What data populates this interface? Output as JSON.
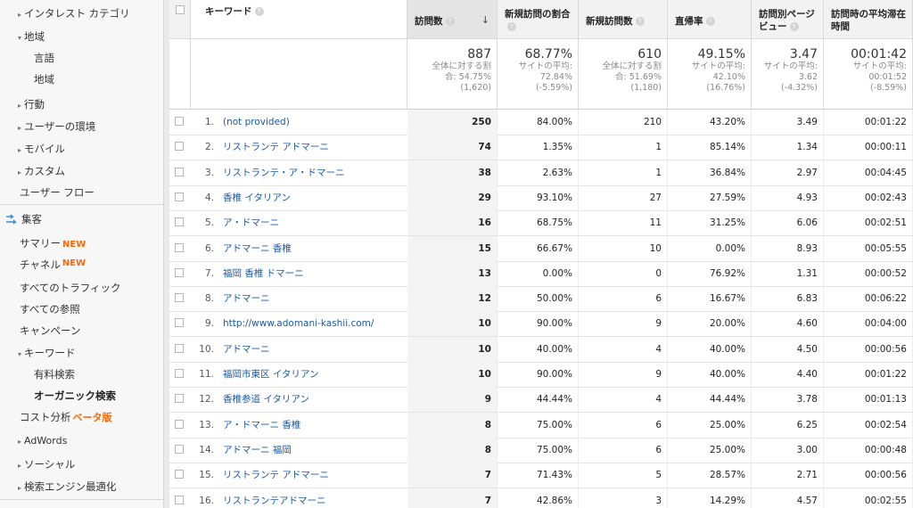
{
  "sidebar": {
    "items": [
      {
        "label": "インタレスト カテゴリ",
        "arrow": "▸"
      },
      {
        "label": "地域",
        "arrow": "▾"
      },
      {
        "label": "言語",
        "arrow": ""
      },
      {
        "label": "地域",
        "arrow": ""
      },
      {
        "label": "行動",
        "arrow": "▸"
      },
      {
        "label": "ユーザーの環境",
        "arrow": "▸"
      },
      {
        "label": "モバイル",
        "arrow": "▸"
      },
      {
        "label": "カスタム",
        "arrow": "▸"
      },
      {
        "label": "ユーザー フロー",
        "arrow": ""
      },
      {
        "label": "集客",
        "arrow": ""
      },
      {
        "label": "サマリー",
        "arrow": "",
        "badge": "NEW"
      },
      {
        "label": "チャネル",
        "arrow": "",
        "badge": "NEW"
      },
      {
        "label": "すべてのトラフィック",
        "arrow": ""
      },
      {
        "label": "すべての参照",
        "arrow": ""
      },
      {
        "label": "キャンペーン",
        "arrow": ""
      },
      {
        "label": "キーワード",
        "arrow": "▾"
      },
      {
        "label": "有料検索",
        "arrow": ""
      },
      {
        "label": "オーガニック検索",
        "arrow": ""
      },
      {
        "label": "コスト分析",
        "arrow": "",
        "beta": "ベータ版"
      },
      {
        "label": "AdWords",
        "arrow": "▸"
      },
      {
        "label": "ソーシャル",
        "arrow": "▸"
      },
      {
        "label": "検索エンジン最適化",
        "arrow": "▸"
      }
    ]
  },
  "table": {
    "headers": {
      "keyword": "キーワード",
      "visits": "訪問数",
      "new_visit_rate": "新規訪問の割合",
      "new_visits": "新規訪問数",
      "bounce": "直帰率",
      "pv_per_visit": "訪問別ページビュー",
      "avg_duration": "訪問時の平均滞在時間"
    },
    "totals": {
      "visits": {
        "big": "887",
        "l1": "全体に対する割",
        "l2": "合: 54.75%",
        "l3": "(1,620)"
      },
      "new_visit_rate": {
        "big": "68.77%",
        "l1": "サイトの平均:",
        "l2": "72.84%",
        "l3": "(-5.59%)"
      },
      "new_visits": {
        "big": "610",
        "l1": "全体に対する割",
        "l2": "合: 51.69%",
        "l3": "(1,180)"
      },
      "bounce": {
        "big": "49.15%",
        "l1": "サイトの平均:",
        "l2": "42.10%",
        "l3": "(16.76%)"
      },
      "pv_per_visit": {
        "big": "3.47",
        "l1": "サイトの平均:",
        "l2": "3.62",
        "l3": "(-4.32%)"
      },
      "avg_duration": {
        "big": "00:01:42",
        "l1": "サイトの平均:",
        "l2": "00:01:52",
        "l3": "(-8.59%)"
      }
    },
    "rows": [
      {
        "idx": "1.",
        "kw": "(not provided)",
        "visits": "250",
        "nvr": "84.00%",
        "nv": "210",
        "bounce": "43.20%",
        "pv": "3.49",
        "dur": "00:01:22"
      },
      {
        "idx": "2.",
        "kw": "リストランテ アドマーニ",
        "visits": "74",
        "nvr": "1.35%",
        "nv": "1",
        "bounce": "85.14%",
        "pv": "1.34",
        "dur": "00:00:11"
      },
      {
        "idx": "3.",
        "kw": "リストランテ・ア・ドマーニ",
        "visits": "38",
        "nvr": "2.63%",
        "nv": "1",
        "bounce": "36.84%",
        "pv": "2.97",
        "dur": "00:04:45"
      },
      {
        "idx": "4.",
        "kw": "香椎 イタリアン",
        "visits": "29",
        "nvr": "93.10%",
        "nv": "27",
        "bounce": "27.59%",
        "pv": "4.93",
        "dur": "00:02:43"
      },
      {
        "idx": "5.",
        "kw": "ア・ドマーニ",
        "visits": "16",
        "nvr": "68.75%",
        "nv": "11",
        "bounce": "31.25%",
        "pv": "6.06",
        "dur": "00:02:51"
      },
      {
        "idx": "6.",
        "kw": "アドマーニ 香椎",
        "visits": "15",
        "nvr": "66.67%",
        "nv": "10",
        "bounce": "0.00%",
        "pv": "8.93",
        "dur": "00:05:55"
      },
      {
        "idx": "7.",
        "kw": "福岡 香椎 ドマーニ",
        "visits": "13",
        "nvr": "0.00%",
        "nv": "0",
        "bounce": "76.92%",
        "pv": "1.31",
        "dur": "00:00:52"
      },
      {
        "idx": "8.",
        "kw": "アドマーニ",
        "visits": "12",
        "nvr": "50.00%",
        "nv": "6",
        "bounce": "16.67%",
        "pv": "6.83",
        "dur": "00:06:22"
      },
      {
        "idx": "9.",
        "kw": "http://www.adomani-kashii.com/",
        "visits": "10",
        "nvr": "90.00%",
        "nv": "9",
        "bounce": "20.00%",
        "pv": "4.60",
        "dur": "00:04:00"
      },
      {
        "idx": "10.",
        "kw": "アドマーニ",
        "visits": "10",
        "nvr": "40.00%",
        "nv": "4",
        "bounce": "40.00%",
        "pv": "4.50",
        "dur": "00:00:56"
      },
      {
        "idx": "11.",
        "kw": "福岡市東区 イタリアン",
        "visits": "10",
        "nvr": "90.00%",
        "nv": "9",
        "bounce": "40.00%",
        "pv": "4.40",
        "dur": "00:01:22"
      },
      {
        "idx": "12.",
        "kw": "香椎参道 イタリアン",
        "visits": "9",
        "nvr": "44.44%",
        "nv": "4",
        "bounce": "44.44%",
        "pv": "3.78",
        "dur": "00:01:13"
      },
      {
        "idx": "13.",
        "kw": "ア・ドマーニ 香椎",
        "visits": "8",
        "nvr": "75.00%",
        "nv": "6",
        "bounce": "25.00%",
        "pv": "6.25",
        "dur": "00:02:54"
      },
      {
        "idx": "14.",
        "kw": "アドマーニ 福岡",
        "visits": "8",
        "nvr": "75.00%",
        "nv": "6",
        "bounce": "25.00%",
        "pv": "3.00",
        "dur": "00:00:48"
      },
      {
        "idx": "15.",
        "kw": "リストランテ アドマーニ",
        "visits": "7",
        "nvr": "71.43%",
        "nv": "5",
        "bounce": "28.57%",
        "pv": "2.71",
        "dur": "00:00:56"
      },
      {
        "idx": "16.",
        "kw": "リストランテアドマーニ",
        "visits": "7",
        "nvr": "42.86%",
        "nv": "3",
        "bounce": "14.29%",
        "pv": "4.57",
        "dur": "00:02:55"
      }
    ]
  }
}
